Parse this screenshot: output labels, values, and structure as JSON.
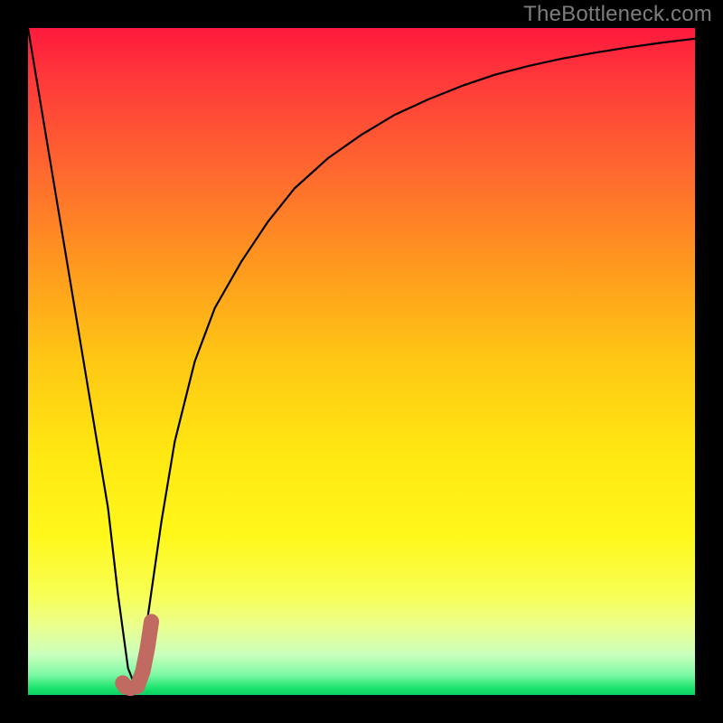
{
  "watermark": "TheBottleneck.com",
  "chart_data": {
    "type": "line",
    "title": "",
    "xlabel": "",
    "ylabel": "",
    "xlim": [
      0,
      100
    ],
    "ylim": [
      0,
      100
    ],
    "grid": false,
    "series": [
      {
        "name": "curve",
        "color": "#000000",
        "stroke_width": 2.2,
        "x": [
          0,
          2,
          4,
          6,
          8,
          10,
          12,
          13.5,
          15,
          16,
          17,
          18,
          20,
          22,
          25,
          28,
          32,
          36,
          40,
          45,
          50,
          55,
          60,
          65,
          70,
          75,
          80,
          85,
          90,
          95,
          100
        ],
        "y": [
          100,
          88,
          76,
          64,
          52,
          40,
          28,
          15,
          4,
          1.5,
          4,
          12,
          26,
          38,
          50,
          58,
          65,
          71,
          76,
          80.5,
          84,
          87,
          89.3,
          91.3,
          93,
          94.3,
          95.4,
          96.3,
          97.1,
          97.8,
          98.4
        ]
      },
      {
        "name": "marker",
        "shape": "j-hook",
        "color": "#c06a62",
        "stroke_width": 17,
        "x": [
          14.2,
          14.6,
          15.4,
          16.4,
          17.2,
          17.9,
          18.5
        ],
        "y": [
          1.8,
          1.2,
          1.0,
          1.3,
          3.5,
          7.0,
          11.0
        ]
      }
    ],
    "gradient_stops": [
      {
        "pos": 0.0,
        "color": "#ff1a3c"
      },
      {
        "pos": 0.22,
        "color": "#ff6a2e"
      },
      {
        "pos": 0.5,
        "color": "#ffc814"
      },
      {
        "pos": 0.76,
        "color": "#fff71a"
      },
      {
        "pos": 0.94,
        "color": "#c8ffbc"
      },
      {
        "pos": 1.0,
        "color": "#0ad060"
      }
    ]
  }
}
